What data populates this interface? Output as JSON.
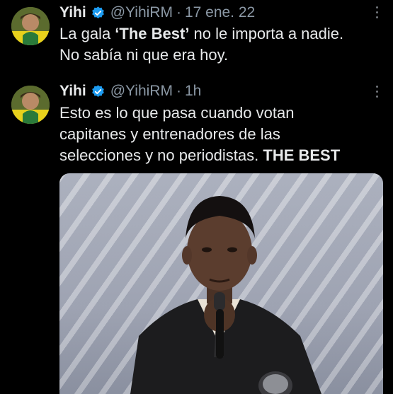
{
  "tweets": [
    {
      "name": "Yihi",
      "handle": "@YihiRM",
      "separator": "·",
      "time": "17 ene. 22",
      "text_parts": [
        "La gala ",
        "‘The Best’",
        " no le importa a nadie.",
        "No sabía ni que era hoy."
      ]
    },
    {
      "name": "Yihi",
      "handle": "@YihiRM",
      "separator": "·",
      "time": "1h",
      "text_parts": [
        "Esto es lo que pasa cuando votan",
        "capitanes y entrenadores de las",
        "selecciones y no periodistas. ",
        "THE BEST"
      ]
    }
  ],
  "colors": {
    "background": "#000000",
    "text": "#e7e9ea",
    "secondary": "#8b98a5",
    "verified": "#1d9bf0"
  },
  "icons": [
    "verified-badge-icon",
    "more-options-icon"
  ]
}
